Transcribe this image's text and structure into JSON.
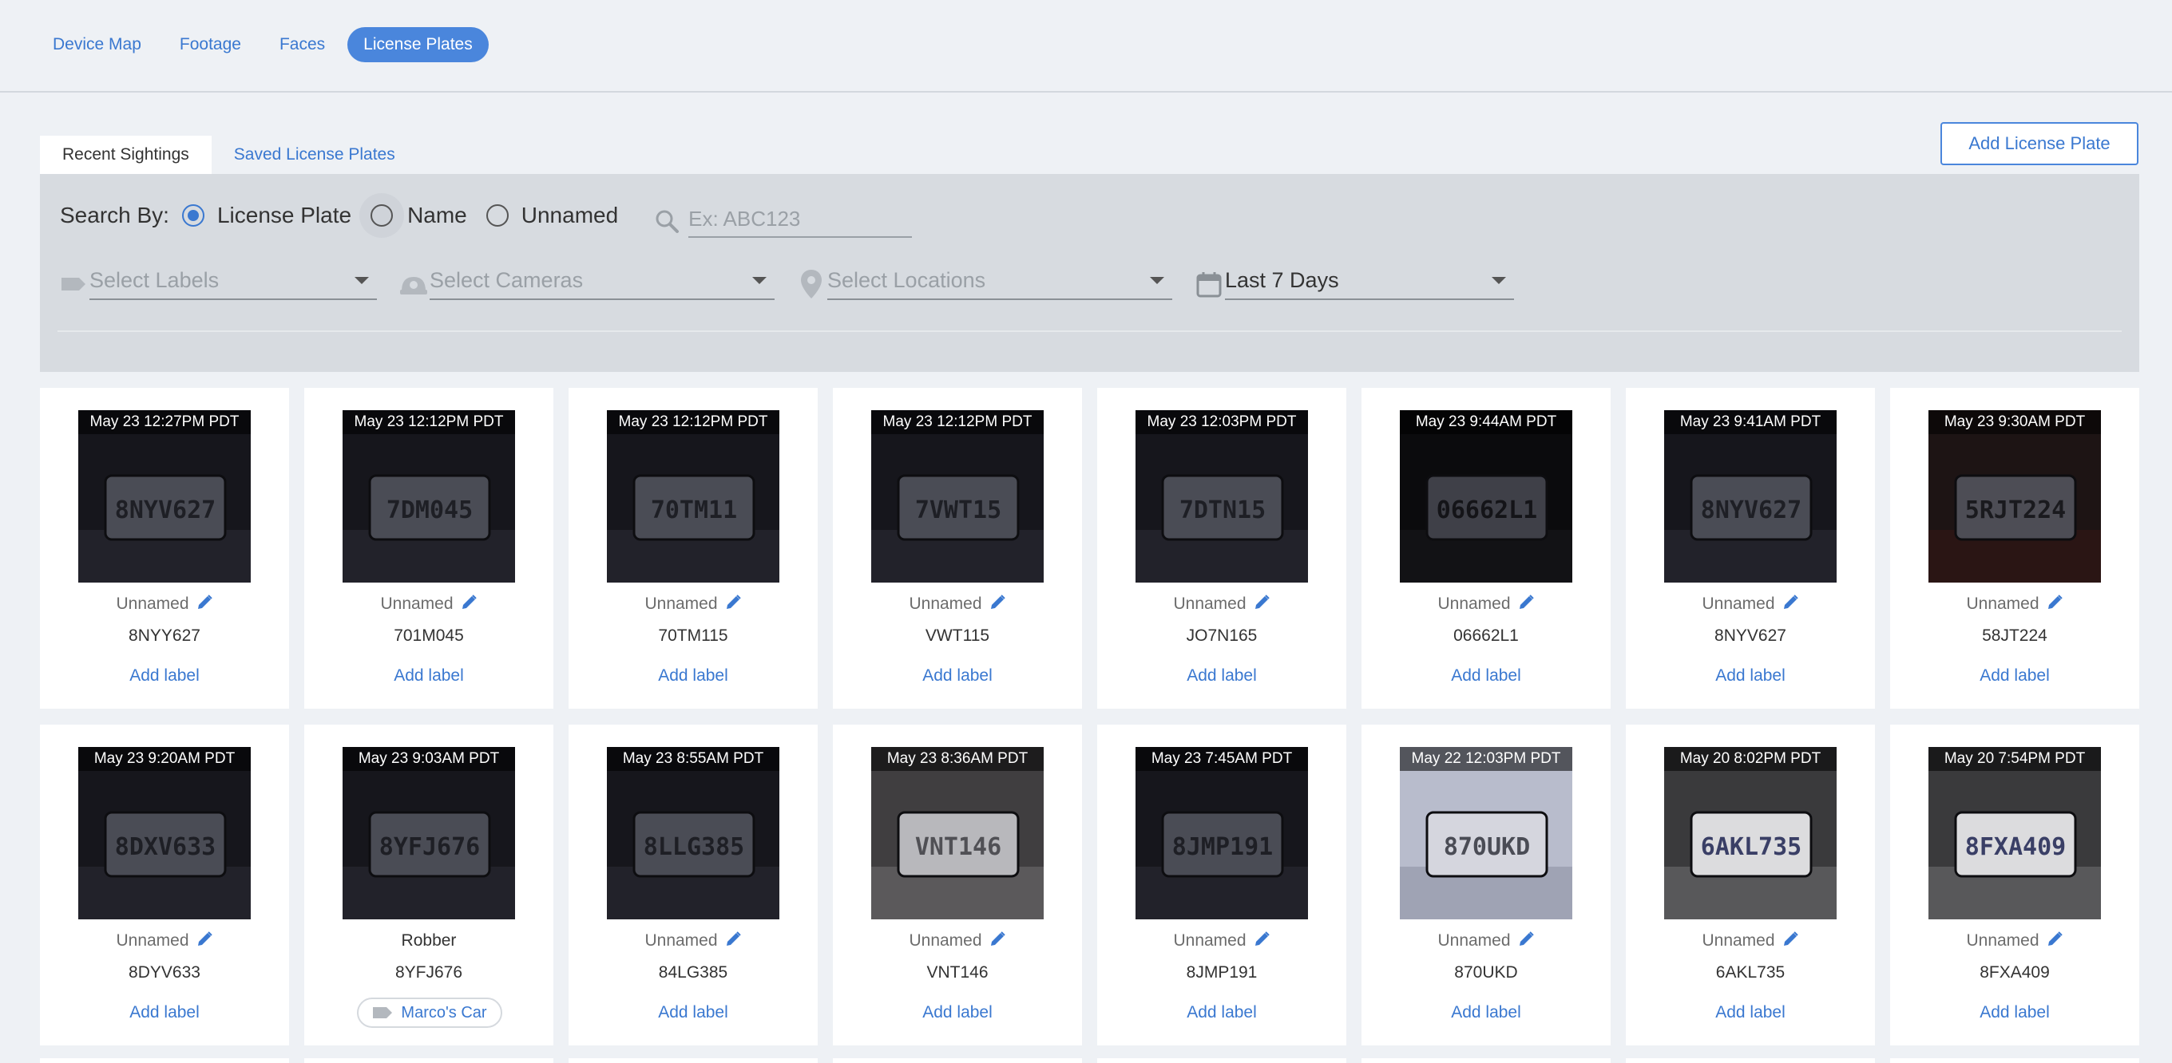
{
  "nav": {
    "items": [
      {
        "label": "Device Map",
        "active": false
      },
      {
        "label": "Footage",
        "active": false
      },
      {
        "label": "Faces",
        "active": false
      },
      {
        "label": "License Plates",
        "active": true
      }
    ]
  },
  "tabs": {
    "recent": "Recent Sightings",
    "saved": "Saved License Plates"
  },
  "add_button": "Add License Plate",
  "search": {
    "by_label": "Search By:",
    "options": [
      "License Plate",
      "Name",
      "Unnamed"
    ],
    "selected": "License Plate",
    "placeholder": "Ex: ABC123"
  },
  "filters": {
    "labels": "Select Labels",
    "cameras": "Select Cameras",
    "locations": "Select Locations",
    "date": "Last 7 Days"
  },
  "add_label_text": "Add label",
  "colors": {
    "accent": "#3a78d0",
    "nav_active_bg": "#4a86dc",
    "panel_bg": "#d7dbe0"
  },
  "sightings": [
    {
      "time": "May 23 12:27PM PDT",
      "name": "Unnamed",
      "plate": "8NYY627",
      "img_plate": "8NYV627",
      "tone": "dark"
    },
    {
      "time": "May 23 12:12PM PDT",
      "name": "Unnamed",
      "plate": "701M045",
      "img_plate": "7DM045",
      "tone": "dark"
    },
    {
      "time": "May 23 12:12PM PDT",
      "name": "Unnamed",
      "plate": "70TM115",
      "img_plate": "70TM11",
      "tone": "dark"
    },
    {
      "time": "May 23 12:12PM PDT",
      "name": "Unnamed",
      "plate": "VWT115",
      "img_plate": "7VWT15",
      "tone": "dark"
    },
    {
      "time": "May 23 12:03PM PDT",
      "name": "Unnamed",
      "plate": "JO7N165",
      "img_plate": "7DTN15",
      "tone": "dark"
    },
    {
      "time": "May 23 9:44AM PDT",
      "name": "Unnamed",
      "plate": "06662L1",
      "img_plate": "06662L1",
      "tone": "black"
    },
    {
      "time": "May 23 9:41AM PDT",
      "name": "Unnamed",
      "plate": "8NYV627",
      "img_plate": "8NYV627",
      "tone": "dark"
    },
    {
      "time": "May 23 9:30AM PDT",
      "name": "Unnamed",
      "plate": "58JT224",
      "img_plate": "5RJT224",
      "tone": "red"
    },
    {
      "time": "May 23 9:20AM PDT",
      "name": "Unnamed",
      "plate": "8DYV633",
      "img_plate": "8DXV633",
      "tone": "dark"
    },
    {
      "time": "May 23 9:03AM PDT",
      "name": "Robber",
      "plate": "8YFJ676",
      "img_plate": "8YFJ676",
      "tone": "dark",
      "chip": "Marco's Car"
    },
    {
      "time": "May 23 8:55AM PDT",
      "name": "Unnamed",
      "plate": "84LG385",
      "img_plate": "8LLG385",
      "tone": "dark"
    },
    {
      "time": "May 23 8:36AM PDT",
      "name": "Unnamed",
      "plate": "VNT146",
      "img_plate": "VNT146",
      "tone": "gray"
    },
    {
      "time": "May 23 7:45AM PDT",
      "name": "Unnamed",
      "plate": "8JMP191",
      "img_plate": "8JMP191",
      "tone": "dark"
    },
    {
      "time": "May 22 12:03PM PDT",
      "name": "Unnamed",
      "plate": "870UKD",
      "img_plate": "870UKD",
      "tone": "light"
    },
    {
      "time": "May 20 8:02PM PDT",
      "name": "Unnamed",
      "plate": "6AKL735",
      "img_plate": "6AKL735",
      "tone": "bright"
    },
    {
      "time": "May 20 7:54PM PDT",
      "name": "Unnamed",
      "plate": "8FXA409",
      "img_plate": "8FXA409",
      "tone": "bright"
    }
  ]
}
